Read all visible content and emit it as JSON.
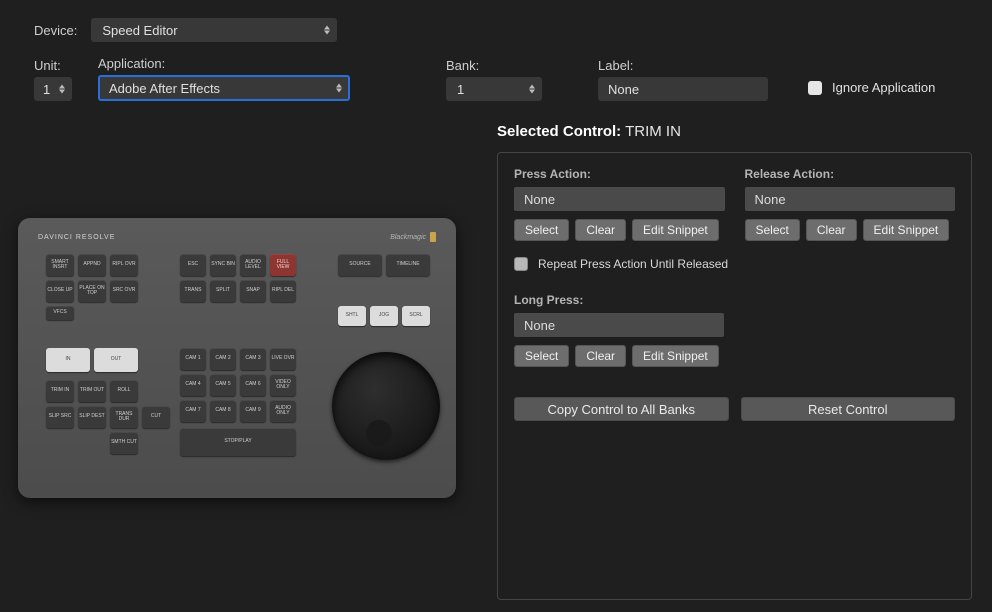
{
  "form": {
    "device_label": "Device:",
    "device_value": "Speed Editor",
    "unit_label": "Unit:",
    "unit_value": "1",
    "application_label": "Application:",
    "application_value": "Adobe After Effects",
    "bank_label": "Bank:",
    "bank_value": "1",
    "label_label": "Label:",
    "label_value": "None",
    "ignore_label": "Ignore Application"
  },
  "selected": {
    "prefix": "Selected Control:",
    "name": "TRIM IN"
  },
  "panel": {
    "press_label": "Press Action:",
    "press_value": "None",
    "release_label": "Release Action:",
    "release_value": "None",
    "long_label": "Long Press:",
    "long_value": "None",
    "select_btn": "Select",
    "clear_btn": "Clear",
    "edit_btn": "Edit Snippet",
    "repeat_label": "Repeat Press Action Until Released",
    "copy_btn": "Copy Control to All Banks",
    "reset_btn": "Reset Control"
  },
  "device": {
    "brand": "DAVINCI RESOLVE",
    "maker": "Blackmagic",
    "keys_top_left": [
      [
        "SMART INSRT",
        "APPND",
        "RIPL OVR"
      ],
      [
        "CLOSE UP",
        "PLACE ON TOP",
        "SRC OVR"
      ],
      [
        "VFCS",
        "",
        ""
      ]
    ],
    "keys_top_mid": [
      [
        "ESC",
        "SYNC BIN",
        "AUDIO LEVEL",
        "FULL VIEW"
      ],
      [
        "TRANS",
        "SPLIT",
        "SNAP",
        "RIPL DEL"
      ]
    ],
    "keys_top_right_row1": [
      "SOURCE",
      "TIMELINE"
    ],
    "keys_top_right_row2": [
      "SHTL",
      "JOG",
      "SCRL"
    ],
    "in_out": [
      "IN",
      "OUT"
    ],
    "keys_left_block": [
      [
        "TRIM IN",
        "TRIM OUT",
        "ROLL"
      ],
      [
        "SLIP SRC",
        "SLIP DEST",
        "TRANS DUR",
        "CUT"
      ],
      [
        "",
        "",
        "SMTH CUT"
      ]
    ],
    "keys_cam": [
      [
        "CAM 1",
        "CAM 2",
        "CAM 3",
        "LIVE OVR"
      ],
      [
        "CAM 4",
        "CAM 5",
        "CAM 6",
        "VIDEO ONLY"
      ],
      [
        "CAM 7",
        "CAM 8",
        "CAM 9",
        "AUDIO ONLY"
      ]
    ],
    "stop_play": "STOP/PLAY"
  }
}
